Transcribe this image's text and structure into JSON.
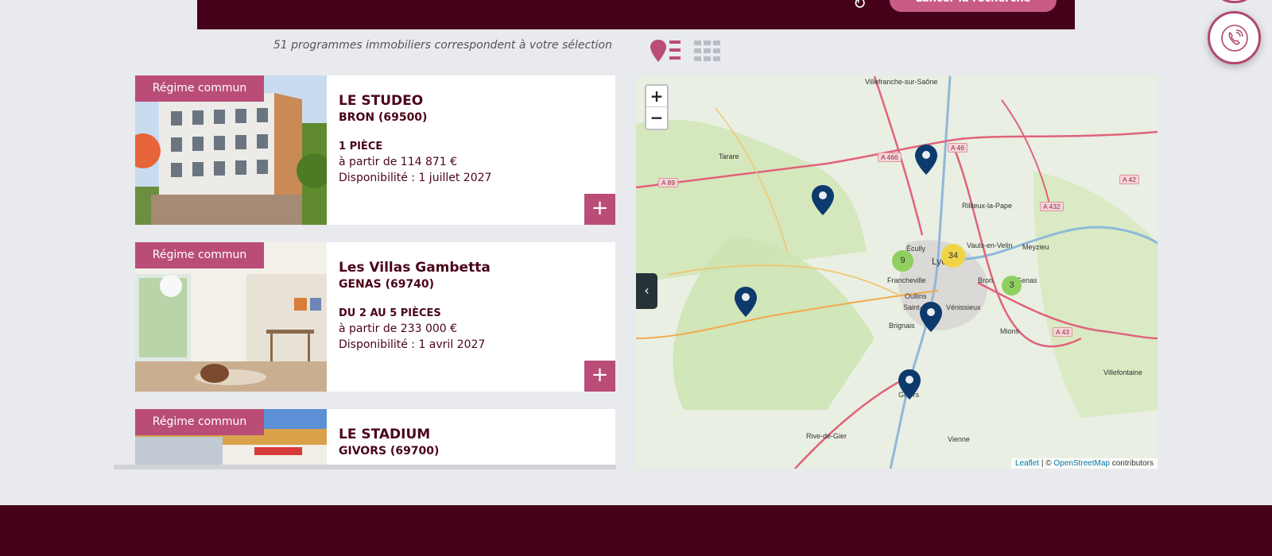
{
  "header": {
    "search_label": "Lancer la recherche"
  },
  "results": {
    "count_text": "51 programmes immobiliers correspondent à votre sélection"
  },
  "listings": [
    {
      "badge": "Régime commun",
      "name": "LE STUDEO",
      "city": "BRON (69500)",
      "rooms": "1 PIÈCE",
      "price": "à partir de 114 871 €",
      "availability": "Disponibilité : 1 juillet 2027"
    },
    {
      "badge": "Régime commun",
      "name": "Les Villas Gambetta",
      "city": "GENAS (69740)",
      "rooms": "DU 2 AU 5 PIÈCES",
      "price": "à partir de 233 000 €",
      "availability": "Disponibilité : 1 avril 2027"
    },
    {
      "badge": "Régime commun",
      "name": "LE STADIUM",
      "city": "GIVORS (69700)"
    }
  ],
  "map": {
    "zoom_in": "+",
    "zoom_out": "−",
    "toggle": "‹",
    "attribution": {
      "leaflet": "Leaflet",
      "separator": " | © ",
      "osm": "OpenStreetMap",
      "contributors": " contributors"
    },
    "clusters": [
      {
        "count": "9"
      },
      {
        "count": "34"
      },
      {
        "count": "3"
      }
    ],
    "places": [
      "Villefranche-sur-Saône",
      "Tarare",
      "Rillieux-la-Pape",
      "Vaulx-en-Velin",
      "Meyzieu",
      "Écully",
      "Lyon",
      "Francheville",
      "Bron",
      "Genas",
      "Oullins",
      "Saint-",
      "Vénissieux",
      "Brignais",
      "Mions",
      "Villefontaine",
      "Givors",
      "Rive-de-Gier",
      "Vienne"
    ],
    "roads": [
      "A 466",
      "A 46",
      "A 89",
      "A 42",
      "A 432",
      "A 43"
    ]
  }
}
